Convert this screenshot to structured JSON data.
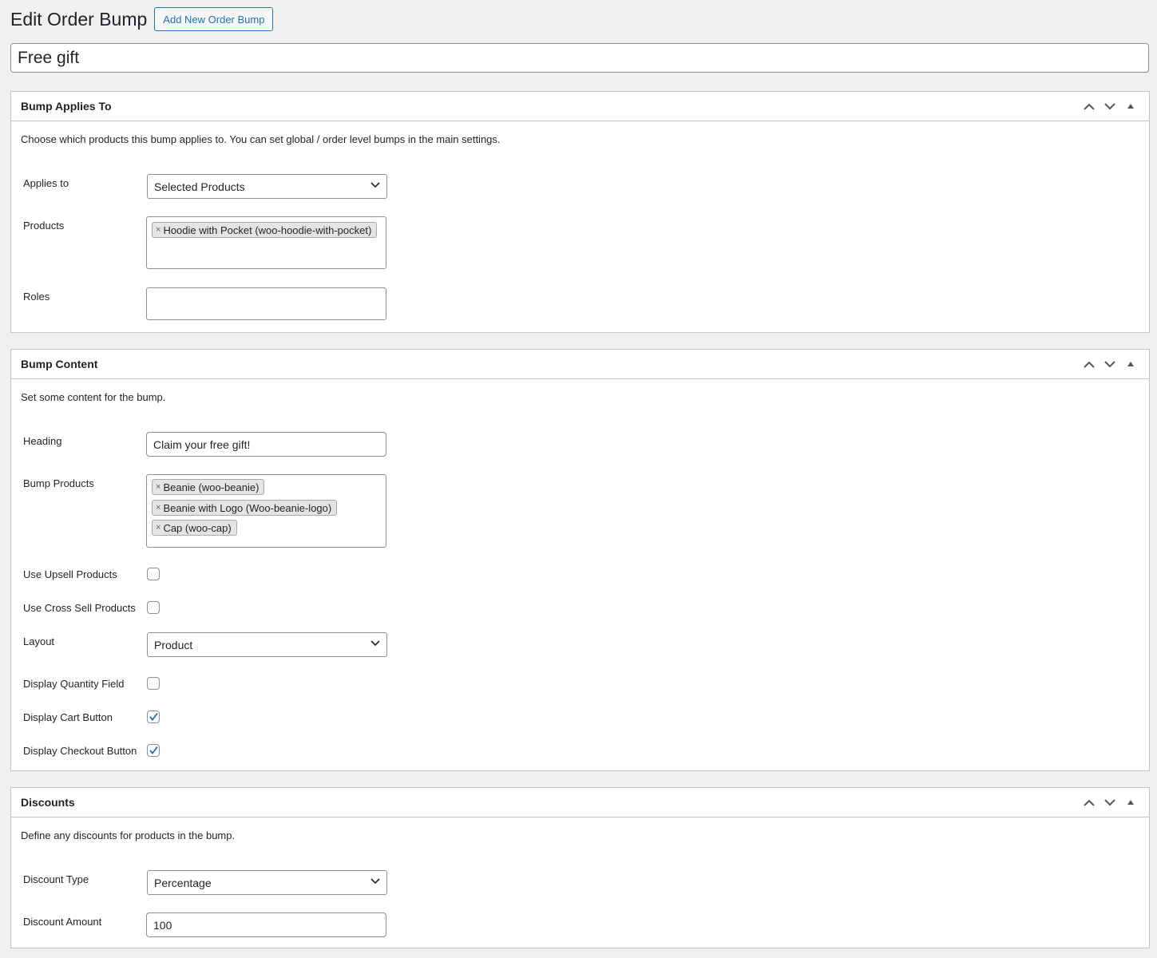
{
  "header": {
    "title": "Edit Order Bump",
    "add_new_label": "Add New Order Bump"
  },
  "post_title": {
    "value": "Free gift"
  },
  "bump_applies_to": {
    "title": "Bump Applies To",
    "description": "Choose which products this bump applies to. You can set global / order level bumps in the main settings.",
    "applies_to_label": "Applies to",
    "applies_to_value": "Selected Products",
    "products_label": "Products",
    "products": [
      "Hoodie with Pocket (woo-hoodie-with-pocket)"
    ],
    "roles_label": "Roles",
    "roles_value": ""
  },
  "bump_content": {
    "title": "Bump Content",
    "description": "Set some content for the bump.",
    "heading_label": "Heading",
    "heading_value": "Claim your free gift!",
    "bump_products_label": "Bump Products",
    "bump_products": [
      "Beanie (woo-beanie)",
      "Beanie with Logo (Woo-beanie-logo)",
      "Cap (woo-cap)"
    ],
    "use_upsell_label": "Use Upsell Products",
    "use_upsell_checked": false,
    "use_cross_sell_label": "Use Cross Sell Products",
    "use_cross_sell_checked": false,
    "layout_label": "Layout",
    "layout_value": "Product",
    "display_quantity_label": "Display Quantity Field",
    "display_quantity_checked": false,
    "display_cart_label": "Display Cart Button",
    "display_cart_checked": true,
    "display_checkout_label": "Display Checkout Button",
    "display_checkout_checked": true
  },
  "discounts": {
    "title": "Discounts",
    "description": "Define any discounts for products in the bump.",
    "discount_type_label": "Discount Type",
    "discount_type_value": "Percentage",
    "discount_amount_label": "Discount Amount",
    "discount_amount_value": "100"
  },
  "icons": {
    "move_up": "chevron-up-icon",
    "move_down": "chevron-down-icon",
    "toggle": "triangle-up-icon",
    "chip_remove": "×"
  },
  "colors": {
    "accent": "#2271b1",
    "background": "#f0f0f1",
    "border": "#c3c4c7",
    "text": "#1d2327"
  }
}
